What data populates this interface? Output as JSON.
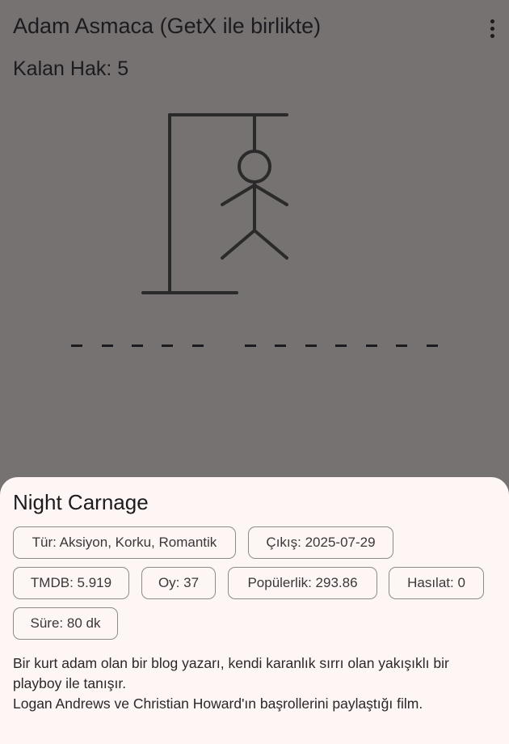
{
  "appbar": {
    "title": "Adam Asmaca (GetX ile birlikte)",
    "menu_icon": "more-vert-icon"
  },
  "game": {
    "remaining_label": "Kalan Hak: 5",
    "remaining_value": 5,
    "word_groups": [
      5,
      7
    ],
    "drawn_parts": [
      "head",
      "body",
      "left-arm",
      "right-arm",
      "left-leg",
      "right-leg"
    ]
  },
  "sheet": {
    "title": "Night Carnage",
    "chips": {
      "genre": "Tür: Aksiyon, Korku, Romantik",
      "release": "Çıkış: 2025-07-29",
      "tmdb": "TMDB: 5.919",
      "votes": "Oy: 37",
      "popularity": "Popülerlik: 293.86",
      "revenue": "Hasılat: 0",
      "runtime": "Süre: 80 dk"
    },
    "overview": "Bir kurt adam olan bir blog yazarı, kendi karanlık sırrı olan yakışıklı bir playboy ile tanışır.\n Logan Andrews ve Christian Howard'ın başrollerini paylaştığı film."
  },
  "colors": {
    "scrim_background": "#777272",
    "sheet_background": "#fef6f5",
    "text": "#1c1b1f",
    "chip_border": "#8c8a8a"
  }
}
